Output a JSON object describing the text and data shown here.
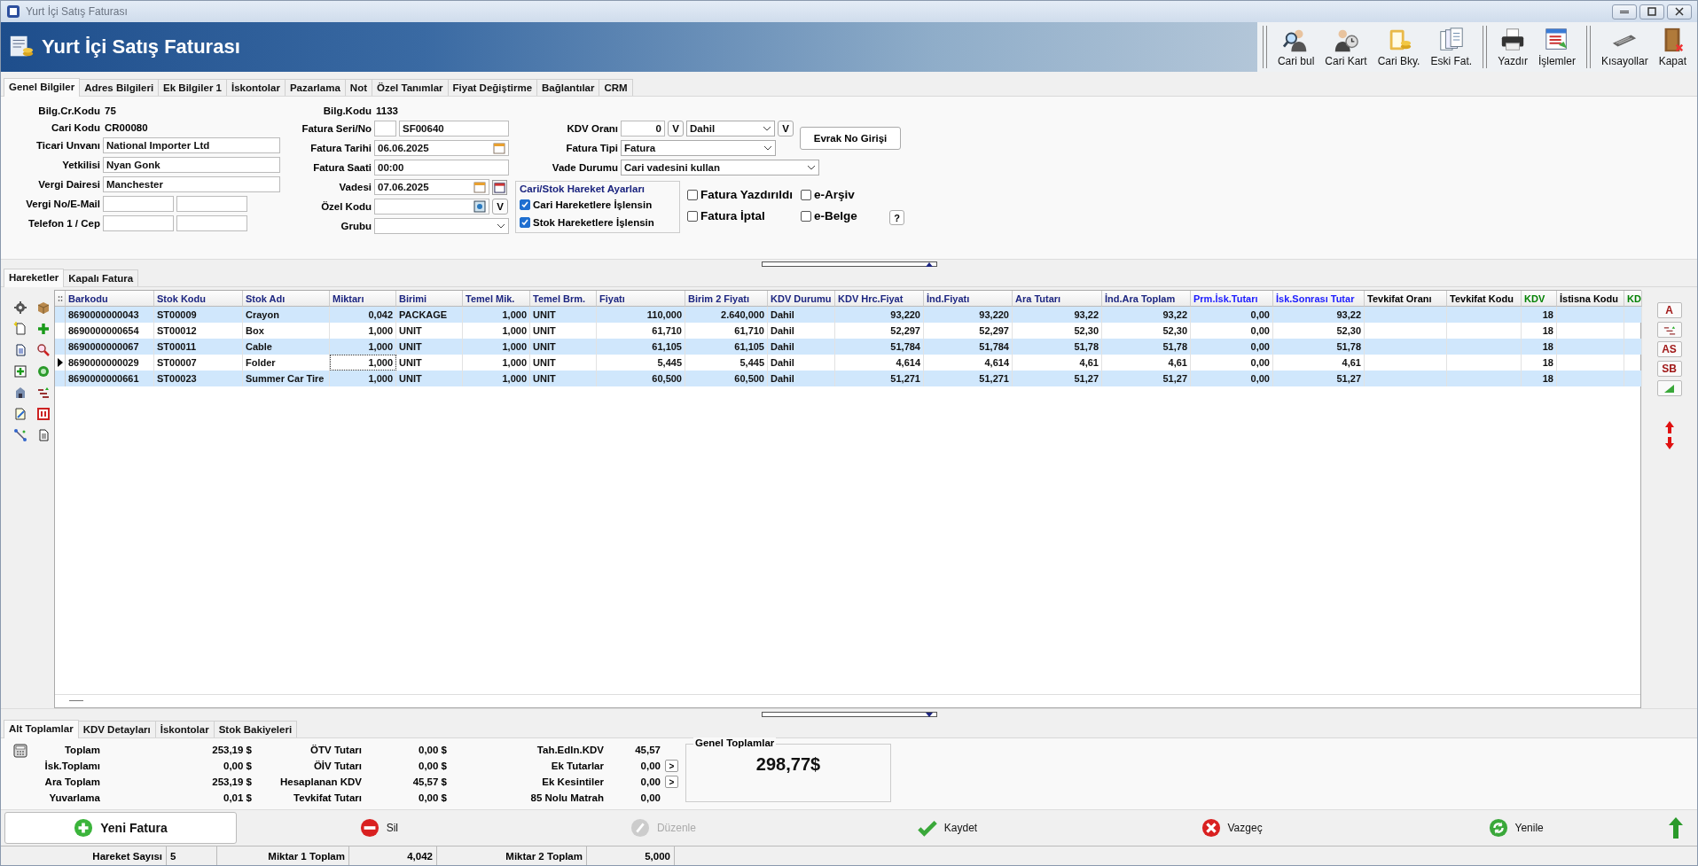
{
  "window": {
    "title": "Yurt İçi Satış Faturası"
  },
  "header": {
    "title": "Yurt İçi Satış Faturası"
  },
  "toolbar": {
    "groups": [
      {
        "buttons": [
          "Cari bul",
          "Cari Kart",
          "Cari Bky.",
          "Eski Fat."
        ]
      },
      {
        "buttons": [
          "Yazdır",
          "İşlemler"
        ]
      },
      {
        "buttons": [
          "Kısayollar",
          "Kapat"
        ]
      }
    ]
  },
  "tabs": [
    {
      "label": "Genel Bilgiler",
      "selected": true
    },
    {
      "label": "Adres Bilgileri",
      "selected": false
    },
    {
      "label": "Ek Bilgiler 1",
      "selected": false
    },
    {
      "label": "İskontolar",
      "selected": false
    },
    {
      "label": "Pazarlama",
      "selected": false
    },
    {
      "label": "Not",
      "selected": false
    },
    {
      "label": "Özel Tanımlar",
      "selected": false
    },
    {
      "label": "Fiyat Değiştirme",
      "selected": false
    },
    {
      "label": "Bağlantılar",
      "selected": false
    },
    {
      "label": "CRM",
      "selected": false
    }
  ],
  "form": {
    "left": [
      {
        "kind": "text",
        "label": "Bilg.Cr.Kodu",
        "value": "75"
      },
      {
        "kind": "text",
        "label": "Cari Kodu",
        "value": "CR00080"
      },
      {
        "kind": "input",
        "label": "Ticari Unvanı",
        "value": "National Importer Ltd"
      },
      {
        "kind": "input",
        "label": "Yetkilisi",
        "value": "Nyan Gonk"
      },
      {
        "kind": "input",
        "label": "Vergi Dairesi",
        "value": "Manchester"
      },
      {
        "kind": "pair",
        "label": "Vergi No/E-Mail"
      },
      {
        "kind": "pair",
        "label": "Telefon 1 / Cep"
      }
    ],
    "middle": [
      {
        "kind": "text",
        "label": "Bilg.Kodu",
        "value": "1133"
      },
      {
        "kind": "serial",
        "label": "Fatura Seri/No",
        "value": "SF00640"
      },
      {
        "kind": "date",
        "label": "Fatura Tarihi",
        "value": "06.06.2025"
      },
      {
        "kind": "input",
        "label": "Fatura Saati",
        "value": "00:00"
      },
      {
        "kind": "due",
        "label": "Vadesi",
        "value": "07.06.2025"
      },
      {
        "kind": "code",
        "label": "Özel Kodu",
        "button": "V"
      },
      {
        "kind": "select",
        "label": "Grubu"
      }
    ],
    "vat": {
      "label": "KDV Oranı",
      "value": "0",
      "button": "V",
      "mode": "Dahil",
      "mode_button": "V"
    },
    "evrak_button": "Evrak No Girişi",
    "invoice_type": {
      "label": "Fatura Tipi",
      "value": "Fatura"
    },
    "due_mode": {
      "label": "Vade Durumu",
      "value": "Cari vadesini kullan"
    },
    "movement_settings": {
      "title": "Cari/Stok Hareket Ayarları",
      "options": [
        {
          "label": "Cari Hareketlere İşlensin",
          "checked": true
        },
        {
          "label": "Stok Hareketlere İşlensin",
          "checked": true
        }
      ]
    },
    "flags": [
      {
        "label": "Fatura Yazdırıldı",
        "checked": false
      },
      {
        "label": "e-Arşiv",
        "checked": false
      },
      {
        "label": "Fatura İptal",
        "checked": false
      },
      {
        "label": "e-Belge",
        "checked": false
      }
    ],
    "help_button": "?"
  },
  "lines_tabs": [
    {
      "label": "Hareketler",
      "selected": true
    },
    {
      "label": "Kapalı Fatura",
      "selected": false
    }
  ],
  "grid": {
    "columns": [
      {
        "label": "Barkodu",
        "color": "#1c2580"
      },
      {
        "label": "Stok Kodu",
        "color": "#1c2580"
      },
      {
        "label": "Stok Adı",
        "color": "#1c2580"
      },
      {
        "label": "Miktarı",
        "color": "#1c2580"
      },
      {
        "label": "Birimi",
        "color": "#1c2580"
      },
      {
        "label": "Temel Mik.",
        "color": "#1c2580"
      },
      {
        "label": "Temel Brm.",
        "color": "#1c2580"
      },
      {
        "label": "Fiyatı",
        "color": "#1c2580"
      },
      {
        "label": "Birim 2 Fiyatı",
        "color": "#1c2580"
      },
      {
        "label": "KDV Durumu",
        "color": "#1c2580"
      },
      {
        "label": "KDV Hrc.Fiyat",
        "color": "#1c2580"
      },
      {
        "label": "İnd.Fiyatı",
        "color": "#1c2580"
      },
      {
        "label": "Ara Tutarı",
        "color": "#1c2580"
      },
      {
        "label": "İnd.Ara Toplam",
        "color": "#1c2580"
      },
      {
        "label": "Prm.İsk.Tutarı",
        "color": "#1a1aff"
      },
      {
        "label": "İsk.Sonrası Tutar",
        "color": "#1a1aff"
      },
      {
        "label": "Tevkifat Oranı",
        "color": "#000000"
      },
      {
        "label": "Tevkifat Kodu",
        "color": "#000000"
      },
      {
        "label": "KDV",
        "color": "#008000"
      },
      {
        "label": "İstisna Kodu",
        "color": "#000000"
      },
      {
        "label": "KD",
        "color": "#008000"
      }
    ],
    "rows": [
      {
        "current": false,
        "cells": [
          "8690000000043",
          "ST00009",
          "Crayon",
          "0,042",
          "PACKAGE",
          "1,000",
          "UNIT",
          "110,000",
          "2.640,000",
          "Dahil",
          "93,220",
          "93,220",
          "93,22",
          "93,22",
          "0,00",
          "93,22",
          null,
          null,
          "18",
          null,
          null
        ]
      },
      {
        "current": false,
        "cells": [
          "8690000000654",
          "ST00012",
          "Box",
          "1,000",
          "UNIT",
          "1,000",
          "UNIT",
          "61,710",
          "61,710",
          "Dahil",
          "52,297",
          "52,297",
          "52,30",
          "52,30",
          "0,00",
          "52,30",
          null,
          null,
          "18",
          null,
          null
        ]
      },
      {
        "current": false,
        "cells": [
          "8690000000067",
          "ST00011",
          "Cable",
          "1,000",
          "UNIT",
          "1,000",
          "UNIT",
          "61,105",
          "61,105",
          "Dahil",
          "51,784",
          "51,784",
          "51,78",
          "51,78",
          "0,00",
          "51,78",
          null,
          null,
          "18",
          null,
          null
        ]
      },
      {
        "current": true,
        "cells": [
          "8690000000029",
          "ST00007",
          "Folder",
          "1,000",
          "UNIT",
          "1,000",
          "UNIT",
          "5,445",
          "5,445",
          "Dahil",
          "4,614",
          "4,614",
          "4,61",
          "4,61",
          "0,00",
          "4,61",
          null,
          null,
          "18",
          null,
          null
        ]
      },
      {
        "current": false,
        "cells": [
          "8690000000661",
          "ST00023",
          "Summer Car Tire",
          "1,000",
          "UNIT",
          "1,000",
          "UNIT",
          "60,500",
          "60,500",
          "Dahil",
          "51,271",
          "51,271",
          "51,27",
          "51,27",
          "0,00",
          "51,27",
          null,
          null,
          "18",
          null,
          null
        ]
      }
    ]
  },
  "side_tools": [
    {
      "kind": "letter",
      "label": "A"
    },
    {
      "kind": "abc"
    },
    {
      "kind": "letter",
      "label": "AS"
    },
    {
      "kind": "letter",
      "label": "SB"
    },
    {
      "kind": "corner"
    }
  ],
  "summary_tabs": [
    {
      "label": "Alt Toplamlar",
      "selected": true
    },
    {
      "label": "KDV Detayları",
      "selected": false
    },
    {
      "label": "İskontolar",
      "selected": false
    },
    {
      "label": "Stok Bakiyeleri",
      "selected": false
    }
  ],
  "totals": {
    "columns": [
      [
        {
          "label": "Toplam",
          "value": "253,19 $"
        },
        {
          "label": "İsk.Toplamı",
          "value": "0,00 $"
        },
        {
          "label": "Ara Toplam",
          "value": "253,19 $"
        },
        {
          "label": "Yuvarlama",
          "value": "0,01 $"
        }
      ],
      [
        {
          "label": "ÖTV Tutarı",
          "value": "0,00 $"
        },
        {
          "label": "ÖİV Tutarı",
          "value": "0,00 $"
        },
        {
          "label": "Hesaplanan KDV",
          "value": "45,57 $"
        },
        {
          "label": "Tevkifat Tutarı",
          "value": "0,00 $"
        }
      ],
      [
        {
          "label": "Tah.Edln.KDV",
          "value": "45,57"
        },
        {
          "label": "Ek Tutarlar",
          "value": "0,00",
          "button": ">"
        },
        {
          "label": "Ek Kesintiler",
          "value": "0,00",
          "button": ">"
        },
        {
          "label": "85 Nolu Matrah",
          "value": "0,00"
        }
      ]
    ]
  },
  "grand_total": {
    "title": "Genel Toplamlar",
    "value": "298,77$"
  },
  "actions": [
    {
      "label": "Yeni Fatura",
      "disabled": false
    },
    {
      "label": "Sil",
      "disabled": false
    },
    {
      "label": "Düzenle",
      "disabled": true
    },
    {
      "label": "Kaydet",
      "disabled": false
    },
    {
      "label": "Vazgeç",
      "disabled": false
    },
    {
      "label": "Yenile",
      "disabled": false
    }
  ],
  "status_bar": [
    {
      "label": "Hareket Sayısı",
      "value": "5"
    },
    {
      "label": "Miktar 1 Toplam",
      "value": "4,042"
    },
    {
      "label": "Miktar 2 Toplam",
      "value": "5,000"
    }
  ]
}
